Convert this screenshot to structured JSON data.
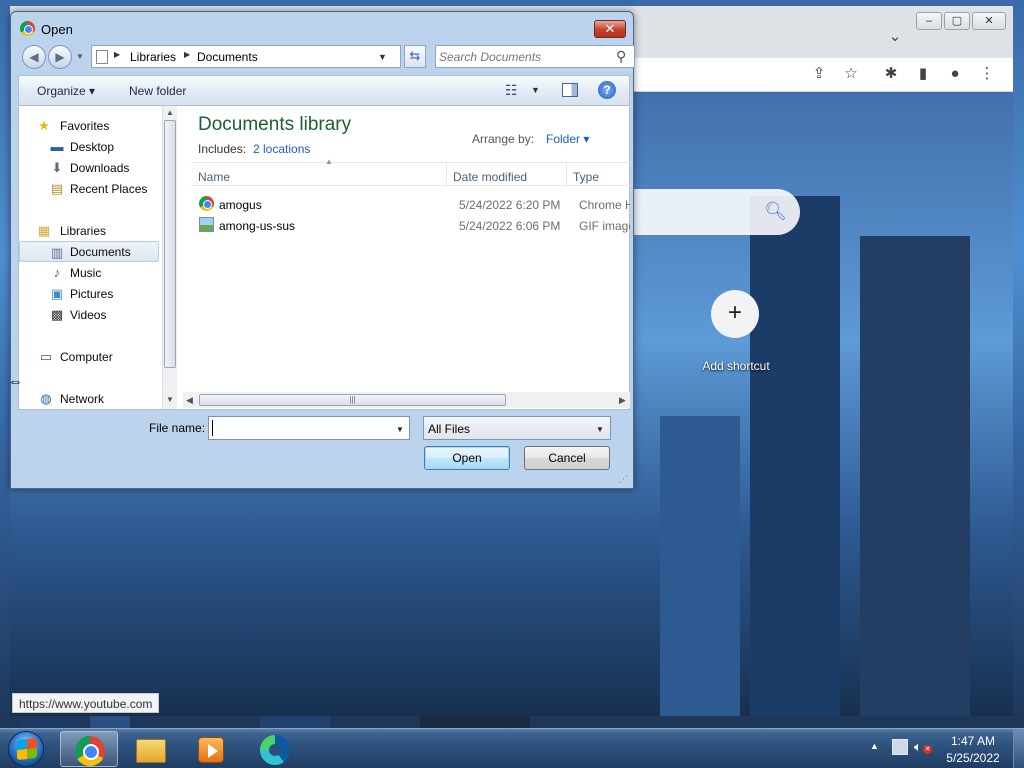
{
  "dialog": {
    "title": "Open",
    "close_label": "✕",
    "address": {
      "root": "Libraries",
      "current": "Documents"
    },
    "search_placeholder": "Search Documents",
    "toolbar": {
      "organize": "Organize ▾",
      "new_folder": "New folder"
    },
    "nav_pane": {
      "items": [
        {
          "label": "Favorites",
          "icon": "star-icon"
        },
        {
          "label": "Desktop",
          "icon": "desktop-icon"
        },
        {
          "label": "Downloads",
          "icon": "downloads-icon"
        },
        {
          "label": "Recent Places",
          "icon": "recent-places-icon"
        },
        {
          "label": "Libraries",
          "icon": "libraries-icon"
        },
        {
          "label": "Documents",
          "icon": "documents-icon",
          "selected": true
        },
        {
          "label": "Music",
          "icon": "music-icon"
        },
        {
          "label": "Pictures",
          "icon": "pictures-icon"
        },
        {
          "label": "Videos",
          "icon": "videos-icon"
        },
        {
          "label": "Computer",
          "icon": "computer-icon"
        },
        {
          "label": "Network",
          "icon": "network-icon"
        }
      ]
    },
    "library": {
      "title": "Documents library",
      "includes_label": "Includes:",
      "includes_link": "2 locations",
      "arrange_label": "Arrange by:",
      "arrange_value": "Folder ▾"
    },
    "columns": {
      "name": "Name",
      "date": "Date modified",
      "type": "Type"
    },
    "files": [
      {
        "name": "amogus",
        "date": "5/24/2022 6:20 PM",
        "type": "Chrome H",
        "icon": "chrome-file-icon"
      },
      {
        "name": "among-us-sus",
        "date": "5/24/2022 6:06 PM",
        "type": "GIF image",
        "icon": "gif-file-icon"
      }
    ],
    "file_name_label": "File name:",
    "file_name_value": "",
    "filter": "All Files",
    "open_label": "Open",
    "cancel_label": "Cancel"
  },
  "chrome": {
    "add_shortcut_label": "Add shortcut",
    "status_url": "https://www.youtube.com"
  },
  "taskbar": {
    "clock_time": "1:47 AM",
    "clock_date": "5/25/2022"
  }
}
